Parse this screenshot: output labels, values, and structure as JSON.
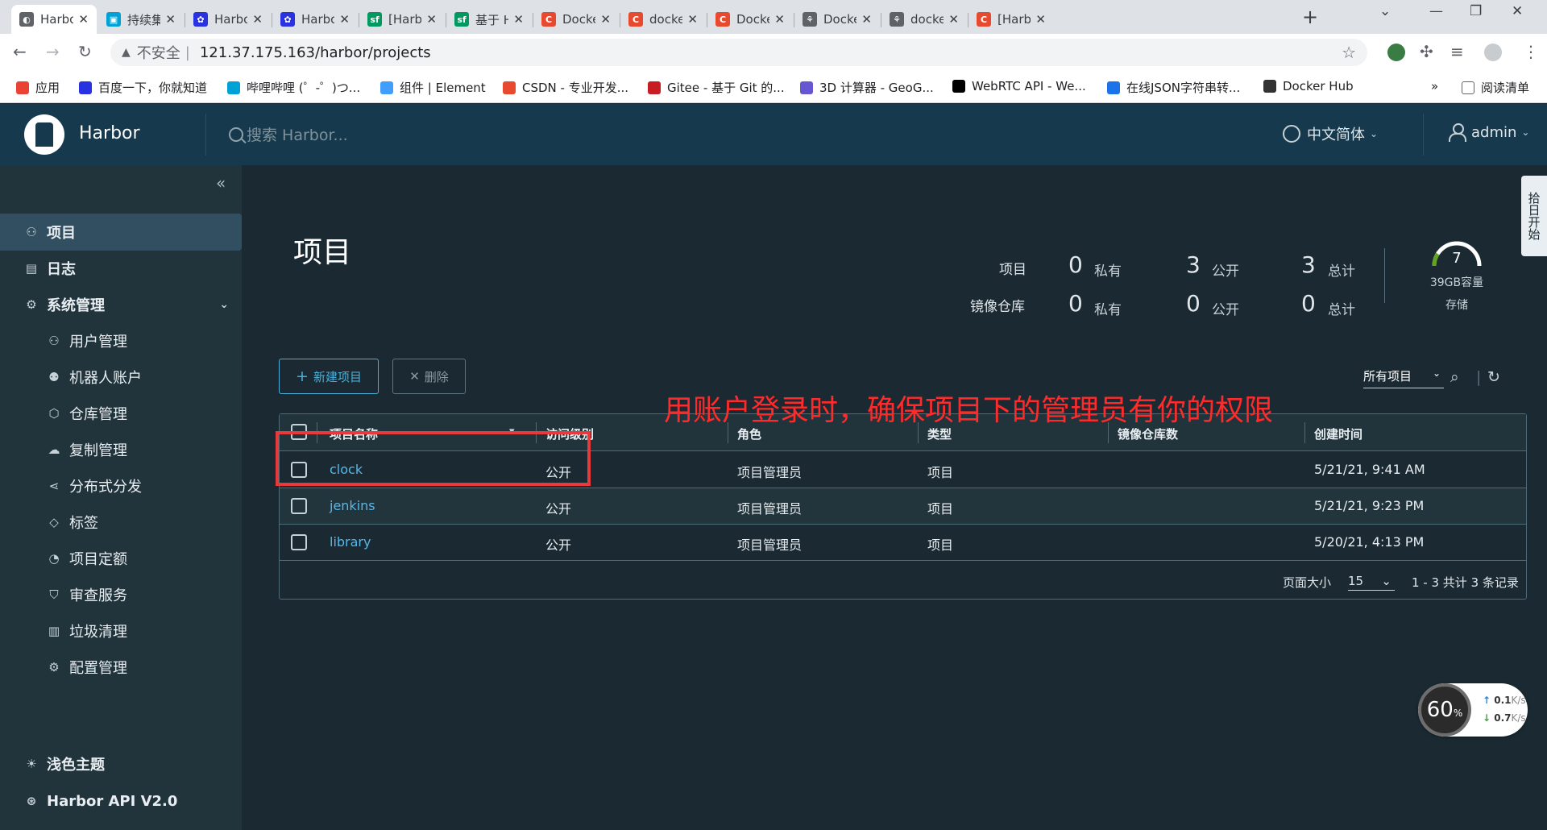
{
  "browser": {
    "tabs": [
      {
        "title": "Harbor",
        "fav_color": "#5f6368",
        "fav_glyph": "◐",
        "active": true
      },
      {
        "title": "持续集成",
        "fav_color": "#00a1d6",
        "fav_glyph": "▣"
      },
      {
        "title": "Harbor",
        "fav_color": "#2932e1",
        "fav_glyph": "✿"
      },
      {
        "title": "Harbor",
        "fav_color": "#2932e1",
        "fav_glyph": "✿"
      },
      {
        "title": "[Harbor",
        "fav_color": "#009a61",
        "fav_glyph": "sf"
      },
      {
        "title": "基于 Ha",
        "fav_color": "#009a61",
        "fav_glyph": "sf"
      },
      {
        "title": "Docker",
        "fav_color": "#e84a2f",
        "fav_glyph": "C"
      },
      {
        "title": "docker",
        "fav_color": "#e84a2f",
        "fav_glyph": "C"
      },
      {
        "title": "Docker",
        "fav_color": "#e84a2f",
        "fav_glyph": "C"
      },
      {
        "title": "Docker",
        "fav_color": "#5f6368",
        "fav_glyph": "⚘"
      },
      {
        "title": "docker",
        "fav_color": "#5f6368",
        "fav_glyph": "⚘"
      },
      {
        "title": "[Harbor",
        "fav_color": "#e84a2f",
        "fav_glyph": "C"
      }
    ],
    "close_glyph": "✕",
    "new_tab": "+",
    "insecure_label": "不安全",
    "url": "121.37.175.163/harbor/projects",
    "bookmarks": [
      {
        "label": "应用",
        "color": "#ea4335"
      },
      {
        "label": "百度一下，你就知道",
        "color": "#2932e1"
      },
      {
        "label": "哔哩哔哩 (゜-゜)つ...",
        "color": "#00a1d6"
      },
      {
        "label": "组件 | Element",
        "color": "#409eff"
      },
      {
        "label": "CSDN - 专业开发...",
        "color": "#e84a2f"
      },
      {
        "label": "Gitee - 基于 Git 的...",
        "color": "#c71d23"
      },
      {
        "label": "3D 计算器 - GeoG...",
        "color": "#6557d2"
      },
      {
        "label": "WebRTC API - We...",
        "color": "#000000"
      },
      {
        "label": "在线JSON字符串转...",
        "color": "#1a73e8"
      },
      {
        "label": "Docker Hub",
        "color": "#333333"
      }
    ],
    "more": "»",
    "reading_list": "阅读清单"
  },
  "header": {
    "brand": "Harbor",
    "search_placeholder": "搜索 Harbor...",
    "language": "中文简体",
    "user": "admin"
  },
  "sidebar": {
    "collapse_glyph": "«",
    "items": [
      {
        "label": "项目",
        "icon": "projects-icon",
        "glyph": "⚇",
        "active": true,
        "level": "top"
      },
      {
        "label": "日志",
        "icon": "logs-icon",
        "glyph": "▤",
        "level": "top"
      },
      {
        "label": "系统管理",
        "icon": "admin-icon",
        "glyph": "⚙",
        "level": "top",
        "expanded": true
      },
      {
        "label": "用户管理",
        "icon": "users-icon",
        "glyph": "⚇",
        "level": "sub"
      },
      {
        "label": "机器人账户",
        "icon": "robot-icon",
        "glyph": "⚉",
        "level": "sub"
      },
      {
        "label": "仓库管理",
        "icon": "registry-icon",
        "glyph": "⬡",
        "level": "sub"
      },
      {
        "label": "复制管理",
        "icon": "replication-icon",
        "glyph": "☁",
        "level": "sub"
      },
      {
        "label": "分布式分发",
        "icon": "distribution-icon",
        "glyph": "⋖",
        "level": "sub"
      },
      {
        "label": "标签",
        "icon": "tag-icon",
        "glyph": "◇",
        "level": "sub"
      },
      {
        "label": "项目定额",
        "icon": "quota-icon",
        "glyph": "◔",
        "level": "sub"
      },
      {
        "label": "审查服务",
        "icon": "scanner-icon",
        "glyph": "⛉",
        "level": "sub"
      },
      {
        "label": "垃圾清理",
        "icon": "trash-icon",
        "glyph": "▥",
        "level": "sub"
      },
      {
        "label": "配置管理",
        "icon": "config-icon",
        "glyph": "⚙",
        "level": "sub"
      }
    ],
    "theme": "浅色主题",
    "api": "Harbor API V2.0"
  },
  "main": {
    "title": "项目",
    "stats": {
      "projects_label": "项目",
      "repos_label": "镜像仓库",
      "private_label": "私有",
      "public_label": "公开",
      "total_label": "总计",
      "projects_private": "0",
      "projects_public": "3",
      "projects_total": "3",
      "repos_private": "0",
      "repos_public": "0",
      "repos_total": "0",
      "storage_value": "7",
      "storage_capacity": "39GB容量",
      "storage_label": "存储",
      "storage_used_fraction": 0.18
    },
    "new_button": "新建项目",
    "delete_button": "删除",
    "filter_value": "所有项目",
    "columns": [
      "项目名称",
      "访问级别",
      "角色",
      "类型",
      "镜像仓库数",
      "创建时间"
    ],
    "rows": [
      {
        "name": "clock",
        "access": "公开",
        "role": "项目管理员",
        "type": "项目",
        "repos": "",
        "created": "5/21/21, 9:41 AM"
      },
      {
        "name": "jenkins",
        "access": "公开",
        "role": "项目管理员",
        "type": "项目",
        "repos": "",
        "created": "5/21/21, 9:23 PM"
      },
      {
        "name": "library",
        "access": "公开",
        "role": "项目管理员",
        "type": "项目",
        "repos": "",
        "created": "5/20/21, 4:13 PM"
      }
    ],
    "page_size_label": "页面大小",
    "page_size": "15",
    "pagination_info": "1 - 3 共计 3 条记录"
  },
  "annotation": "用账户登录时，确保项目下的管理员有你的权限",
  "side_tab": "拾日开始",
  "net_widget": {
    "percent": "60",
    "percent_unit": "%",
    "up": "0.1",
    "down": "0.7",
    "unit": "K/s"
  },
  "colors": {
    "accent": "#49afd9",
    "link": "#57b7e8",
    "annotation": "#ff2b2b",
    "header_bg": "#17394d",
    "sidebar_bg": "#21333b"
  }
}
